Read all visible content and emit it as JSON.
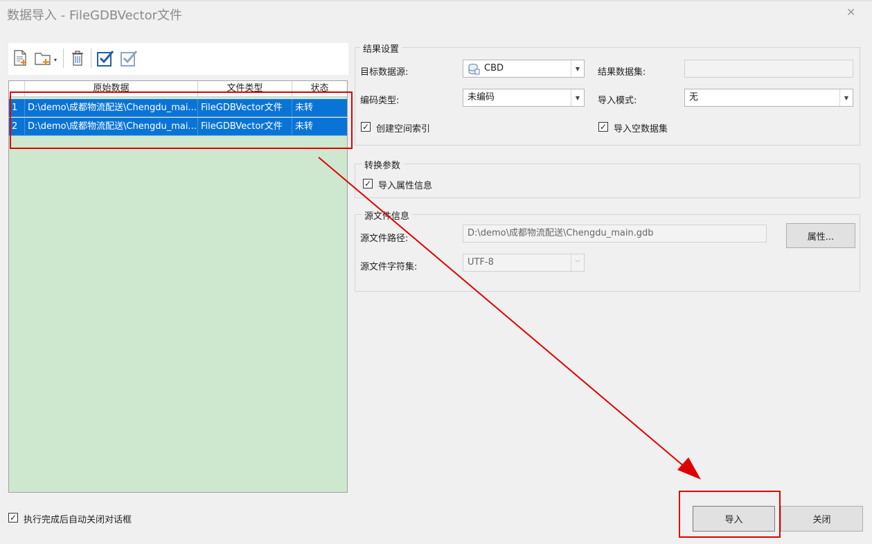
{
  "window": {
    "title": "数据导入 - FileGDBVector文件"
  },
  "toolbar": {
    "icons": [
      "add-file-icon",
      "add-folder-icon",
      "delete-icon",
      "select-all-icon",
      "select-invert-icon"
    ]
  },
  "table": {
    "columns": [
      "原始数据",
      "文件类型",
      "状态"
    ],
    "rows": [
      {
        "index": "1",
        "source": "D:\\demo\\成都物流配送\\Chengdu_mai...",
        "type": "FileGDBVector文件",
        "status": "未转"
      },
      {
        "index": "2",
        "source": "D:\\demo\\成都物流配送\\Chengdu_mai...",
        "type": "FileGDBVector文件",
        "status": "未转"
      }
    ]
  },
  "result_settings": {
    "title": "结果设置",
    "target_datasource_label": "目标数据源:",
    "target_datasource_value": "CBD",
    "result_dataset_label": "结果数据集:",
    "result_dataset_value": "",
    "encoding_label": "编码类型:",
    "encoding_value": "未编码",
    "import_mode_label": "导入模式:",
    "import_mode_value": "无",
    "spatial_index_label": "创建空间索引",
    "spatial_index_checked": true,
    "import_empty_label": "导入空数据集",
    "import_empty_checked": true
  },
  "conversion": {
    "title": "转换参数",
    "import_attributes_label": "导入属性信息",
    "import_attributes_checked": true
  },
  "source_info": {
    "title": "源文件信息",
    "path_label": "源文件路径:",
    "path_value": "D:\\demo\\成都物流配送\\Chengdu_main.gdb",
    "properties_button": "属性...",
    "charset_label": "源文件字符集:",
    "charset_value": "UTF-8"
  },
  "footer": {
    "auto_close_label": "执行完成后自动关闭对话框",
    "auto_close_checked": true,
    "import_button": "导入",
    "close_button": "关闭"
  },
  "colors": {
    "annotation": "#e00000",
    "selection": "#0a74d6",
    "list_bg": "#cde8cf"
  }
}
